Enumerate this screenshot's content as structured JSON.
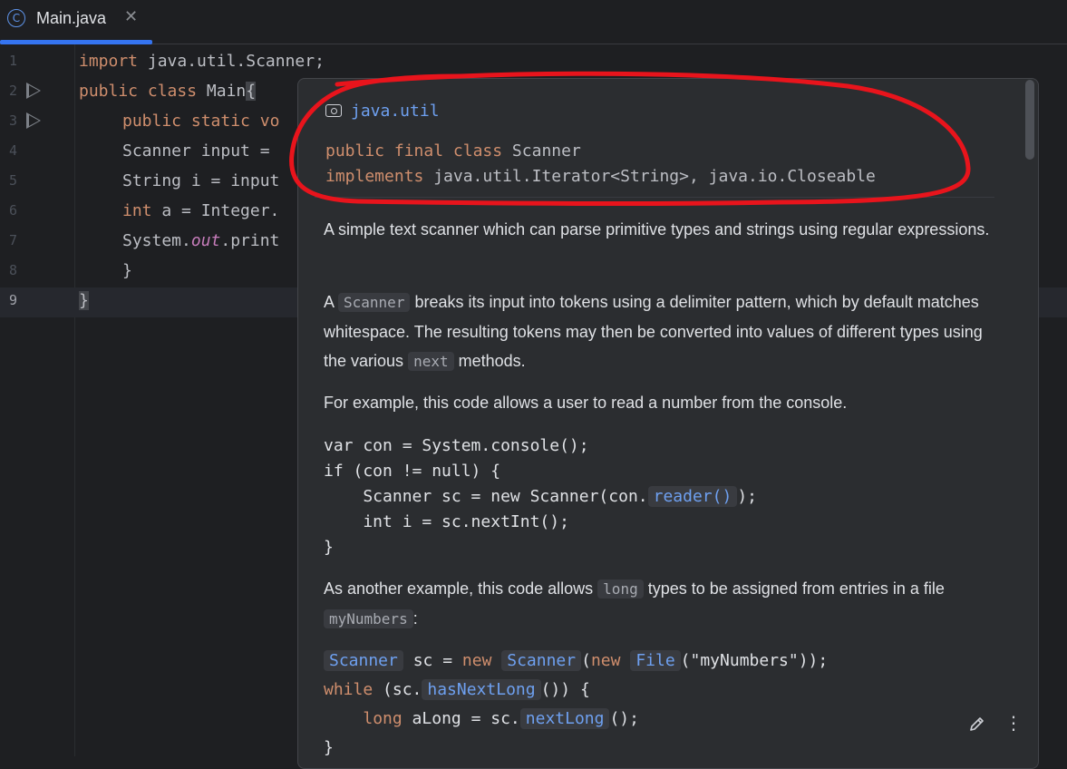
{
  "tab": {
    "icon_letter": "C",
    "title": "Main.java",
    "close": "✕"
  },
  "gutter": {
    "lines": [
      "1",
      "2",
      "3",
      "4",
      "5",
      "6",
      "7",
      "8",
      "9"
    ]
  },
  "code": {
    "l1": {
      "kw": "import",
      "rest": " java.util.Scanner;"
    },
    "l2": {
      "kw1": "public",
      "kw2": "class",
      "name": " Main",
      "brace": "{"
    },
    "l3": {
      "kw1": "public",
      "kw2": "static",
      "rest": " vo"
    },
    "l4": {
      "text": "Scanner input ="
    },
    "l5": {
      "text": "String i = input"
    },
    "l6": {
      "kw": "int",
      "rest": " a = Integer."
    },
    "l7": {
      "a": "System.",
      "b": "out",
      "c": ".print"
    },
    "l8": {
      "text": "}"
    },
    "l9": {
      "text": "}"
    }
  },
  "popup": {
    "package_icon": "package-icon",
    "package": "java.util",
    "decl": {
      "kw1": "public",
      "kw2": "final",
      "kw3": "class",
      "name": " Scanner",
      "kw4": "implements",
      "rest": " java.util.Iterator<String>, java.io.Closeable"
    },
    "p1": "A simple text scanner which can parse primitive types and strings using regular expressions.",
    "p2": {
      "a": "A ",
      "code1": "Scanner",
      "b": " breaks its input into tokens using a delimiter pattern, which by default matches whitespace. The resulting tokens may then be converted into values of different types using the various ",
      "code2": "next",
      "c": " methods."
    },
    "p3": "For example, this code allows a user to read a number from the console.",
    "ex1": {
      "l1": "var con = System.console();",
      "l2": "if (con != null) {",
      "l3a": "    Scanner sc = new Scanner(con.",
      "l3link": "reader()",
      "l3b": ");",
      "l4": "    int i = sc.nextInt();",
      "l5": "}"
    },
    "p4": {
      "a": "As another example, this code allows ",
      "code1": "long",
      "b": " types to be assigned from entries in a file ",
      "code2": "myNumbers",
      "c": ":"
    },
    "ex2": {
      "l1_link1": "Scanner",
      "l1_a": " sc = ",
      "l1_kw": "new",
      "l1_b": " ",
      "l1_link2": "Scanner",
      "l1_c": "(",
      "l1_kw2": "new",
      "l1_d": " ",
      "l1_link3": "File",
      "l1_e": "(\"myNumbers\"));",
      "l2_kw": "while",
      "l2_a": " (sc.",
      "l2_link": "hasNextLong",
      "l2_b": "()) {",
      "l3_a": "    ",
      "l3_kw": "long",
      "l3_b": " aLong = sc.",
      "l3_link": "nextLong",
      "l3_c": "();",
      "l4": "}"
    },
    "edit_icon": "pencil-icon",
    "more_icon": "⋮"
  },
  "annotation": {
    "color": "#e8141c"
  }
}
